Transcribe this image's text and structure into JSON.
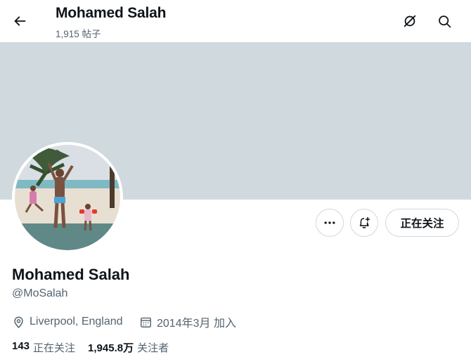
{
  "header": {
    "title": "Mohamed Salah",
    "post_count": "1,915 帖子",
    "back_icon": "arrow-left-icon",
    "grok_icon": "grok-icon",
    "search_icon": "search-icon"
  },
  "profile": {
    "display_name": "Mohamed Salah",
    "handle": "@MoSalah",
    "location": "Liverpool, England",
    "joined": "2014年3月 加入",
    "location_icon": "location-pin-icon",
    "calendar_icon": "calendar-icon"
  },
  "actions": {
    "more_icon": "more-dots-icon",
    "notify_icon": "bell-plus-icon",
    "follow_label": "正在关注"
  },
  "stats": {
    "following_count": "143",
    "following_label": "正在关注",
    "followers_count": "1,945.8万",
    "followers_label": "关注者"
  },
  "colors": {
    "banner": "#cfd9de",
    "text_primary": "#0f1419",
    "text_secondary": "#536471",
    "border": "#cfd9de"
  }
}
